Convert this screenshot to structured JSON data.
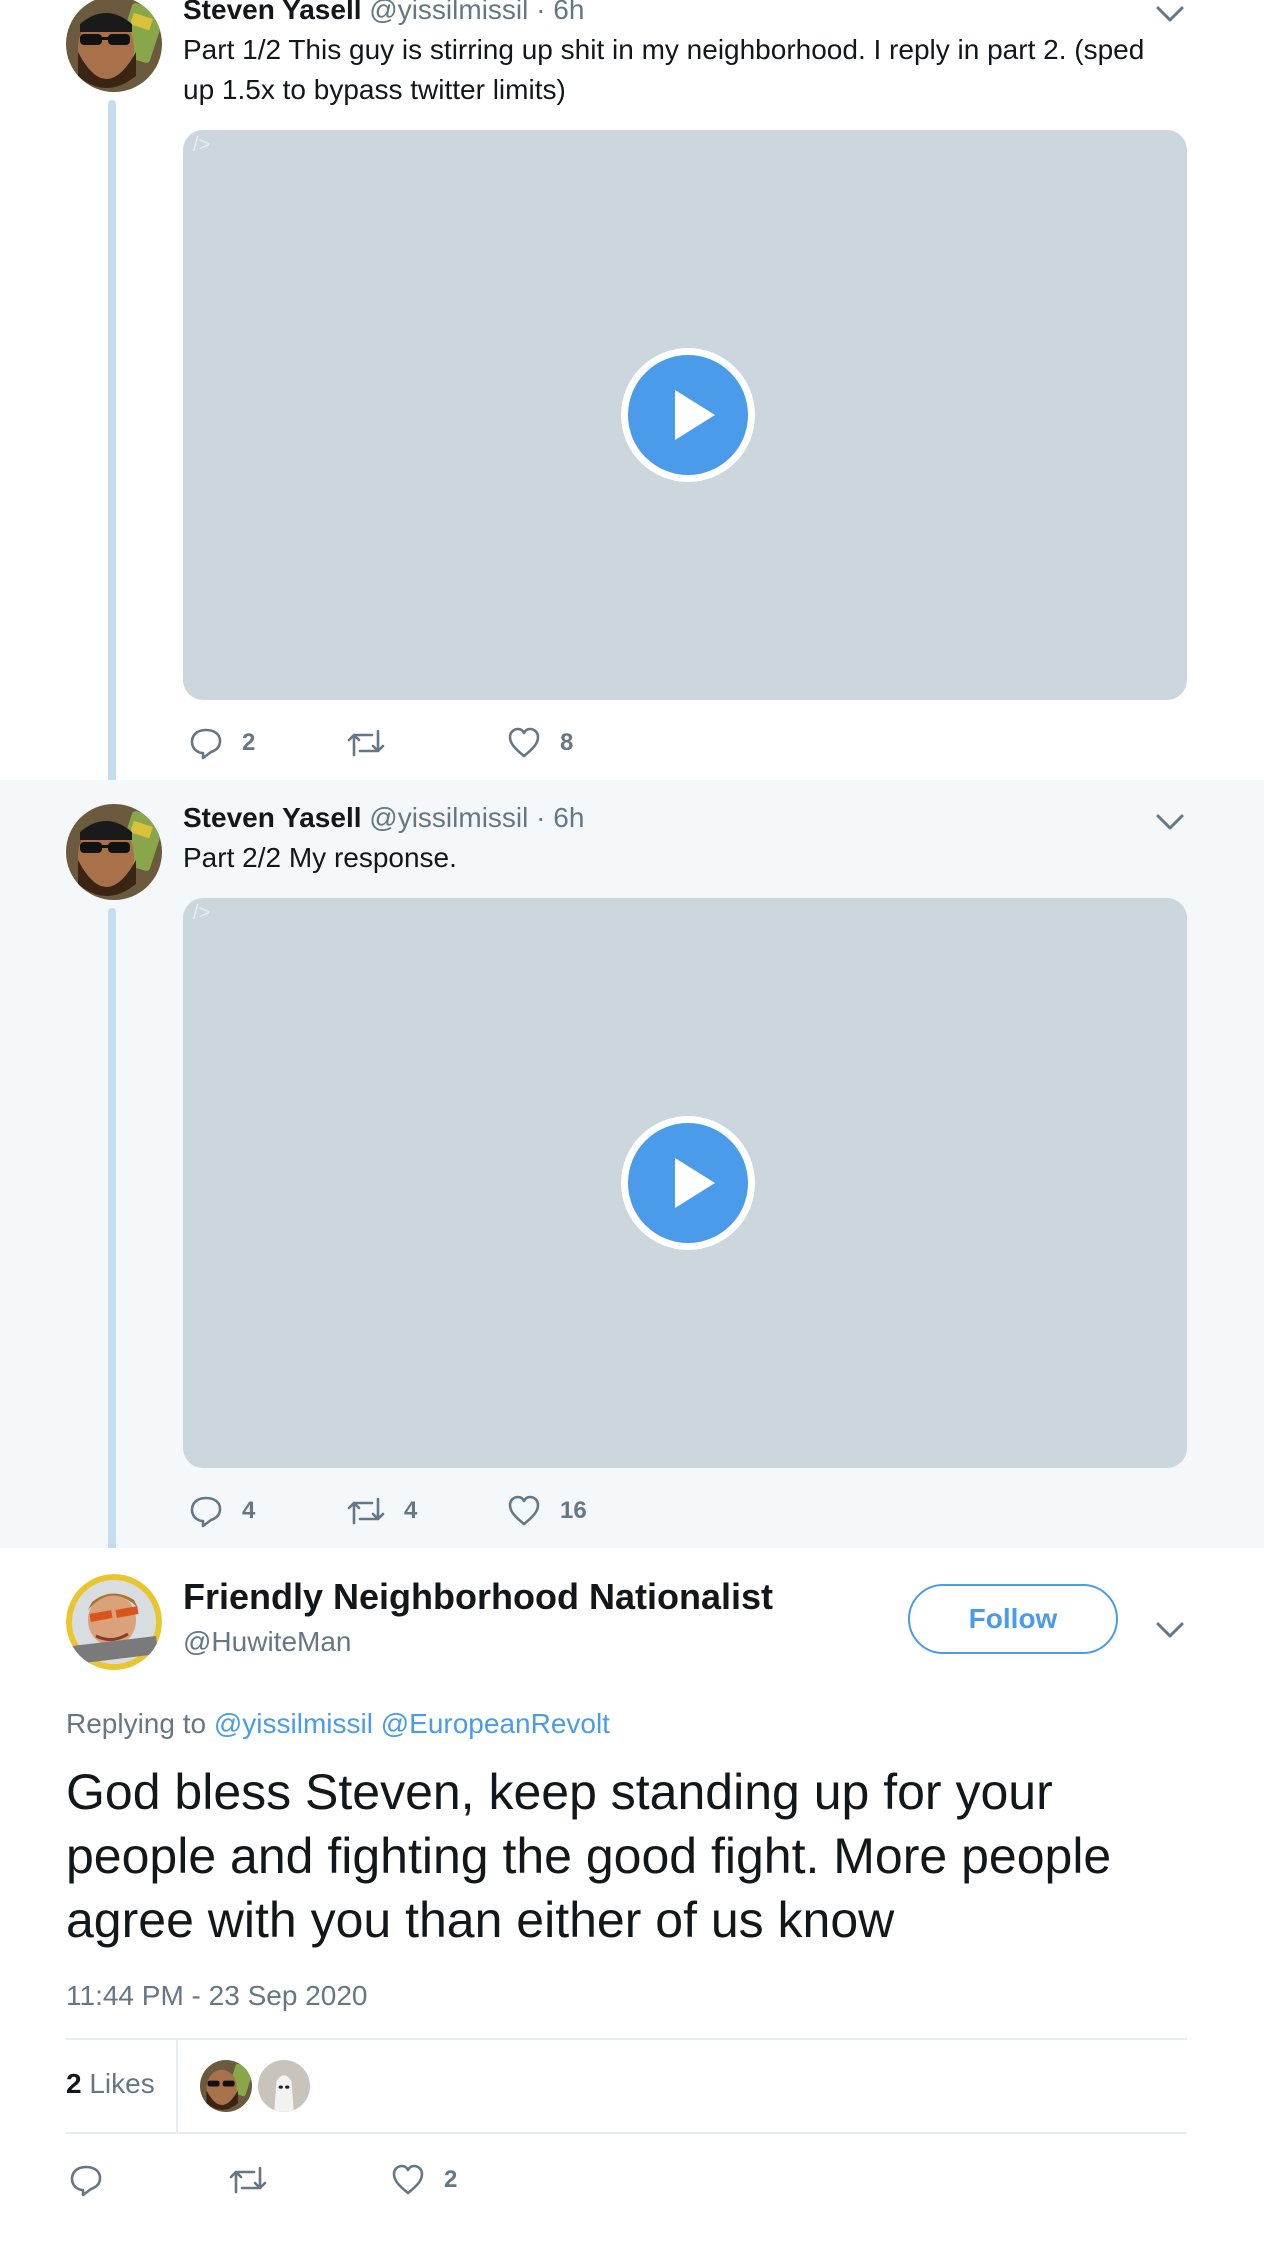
{
  "thread": [
    {
      "author_name": "Steven Yasell",
      "author_handle": "@yissilmissil",
      "separator": "·",
      "time": "6h",
      "text": "Part 1/2 This guy is stirring up shit in my neighborhood. I reply in part 2. (sped up 1.5x to bypass twitter limits)",
      "media_tag": "/>",
      "replies": "2",
      "retweets": "",
      "likes": "8"
    },
    {
      "author_name": "Steven Yasell",
      "author_handle": "@yissilmissil",
      "separator": "·",
      "time": "6h",
      "text": "Part 2/2 My response.",
      "media_tag": "/>",
      "replies": "4",
      "retweets": "4",
      "likes": "16"
    }
  ],
  "main_tweet": {
    "author_name": "Friendly Neighborhood Nationalist",
    "author_handle": "@HuwiteMan",
    "follow_label": "Follow",
    "replying_prefix": "Replying to",
    "replying_to": [
      "@yissilmissil",
      "@EuropeanRevolt"
    ],
    "text": "God bless Steven, keep standing up for your people and fighting the good fight. More people agree with you than either of us know",
    "timestamp": "11:44 PM - 23 Sep 2020",
    "likes_count": "2",
    "likes_word": "Likes",
    "replies": "",
    "retweets": "",
    "likes": "2"
  },
  "colors": {
    "accent": "#4a9be9",
    "thread_line": "#c4dcf0",
    "muted_text": "#657786",
    "media_placeholder": "#ccd6dd",
    "highlight_bg": "#f5f8fa"
  },
  "icons": {
    "reply": "speech-bubble-icon",
    "retweet": "retweet-arrows-icon",
    "like": "heart-icon",
    "menu": "chevron-down-icon",
    "video": "play-icon"
  }
}
